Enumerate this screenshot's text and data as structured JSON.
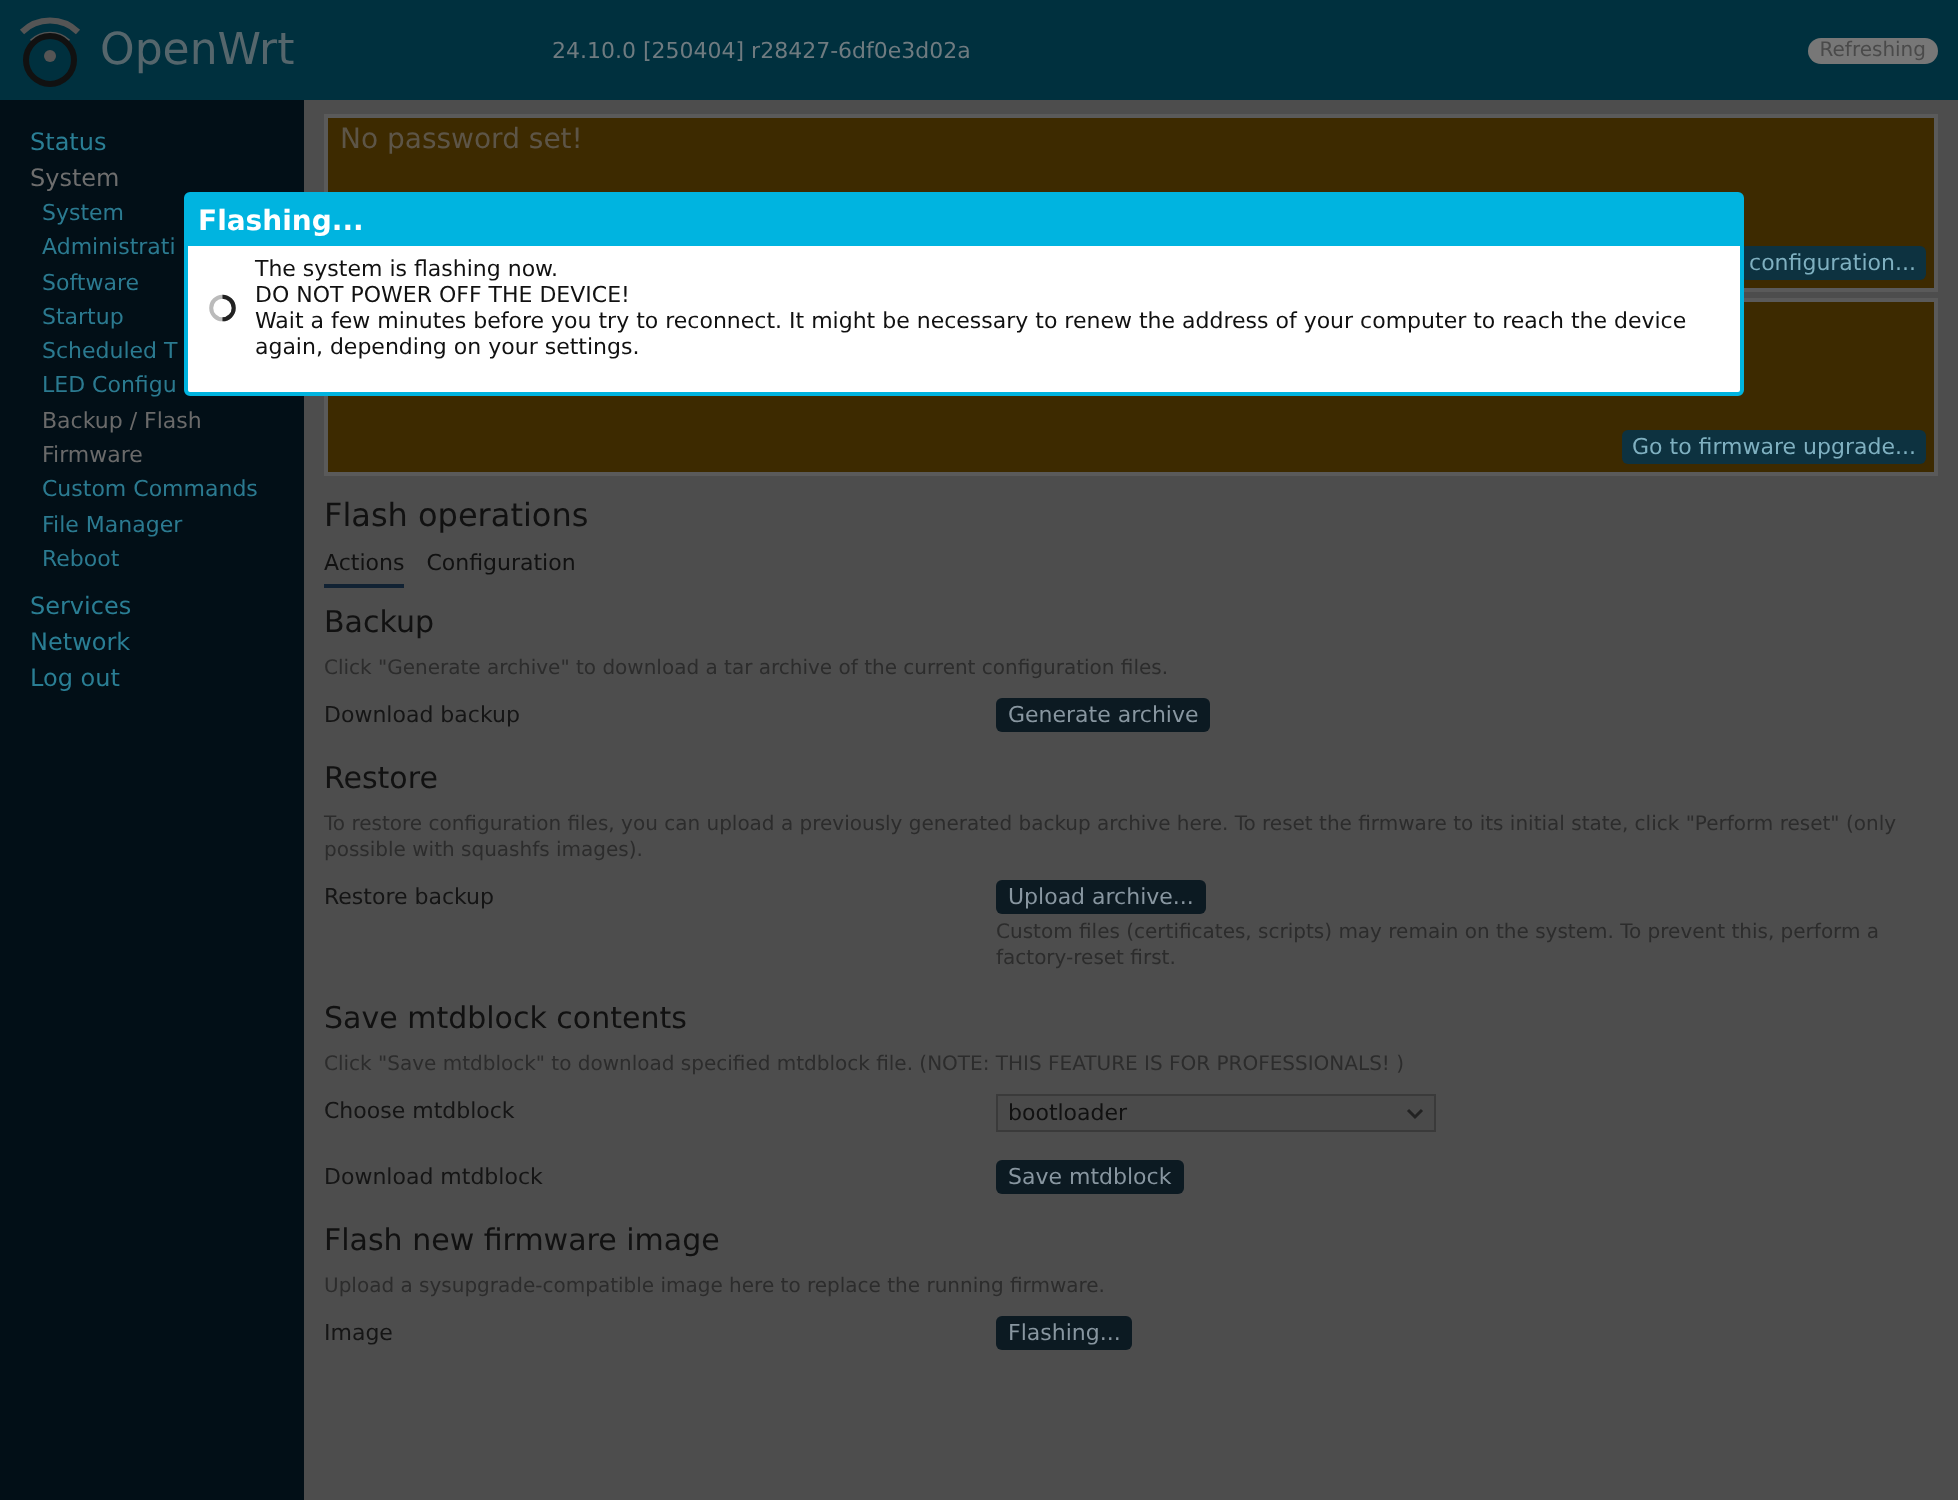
{
  "header": {
    "brand": "OpenWrt",
    "version": "24.10.0 [250404] r28427-6df0e3d02a",
    "indicator": "Refreshing"
  },
  "sidebar": {
    "items": [
      {
        "label": "Status",
        "selected": false
      },
      {
        "label": "System",
        "selected": true,
        "children": [
          {
            "label": "System",
            "selected": false
          },
          {
            "label": "Administrati",
            "selected": false
          },
          {
            "label": "Software",
            "selected": false
          },
          {
            "label": "Startup",
            "selected": false
          },
          {
            "label": "Scheduled T",
            "selected": false
          },
          {
            "label": "LED Configu",
            "selected": false
          },
          {
            "label": "Backup / Flash",
            "selected": true
          },
          {
            "label": "Firmware",
            "selected": true
          },
          {
            "label": "Custom Commands",
            "selected": false
          },
          {
            "label": "File Manager",
            "selected": false
          },
          {
            "label": "Reboot",
            "selected": false
          }
        ]
      },
      {
        "label": "Services",
        "selected": false
      },
      {
        "label": "Network",
        "selected": false
      },
      {
        "label": "Log out",
        "selected": false
      }
    ]
  },
  "banners": [
    {
      "title": "No password set!",
      "button": "configuration..."
    },
    {
      "button": "Go to firmware upgrade..."
    }
  ],
  "page": {
    "title": "Flash operations",
    "tabs": [
      {
        "label": "Actions",
        "selected": true
      },
      {
        "label": "Configuration",
        "selected": false
      }
    ],
    "sections": [
      {
        "title": "Backup",
        "description": "Click \"Generate archive\" to download a tar archive of the current configuration files.",
        "rows": [
          {
            "label": "Download backup",
            "kind": "button",
            "value": "Generate archive"
          }
        ]
      },
      {
        "title": "Restore",
        "description": "To restore configuration files, you can upload a previously generated backup archive here. To reset the firmware to its initial state, click \"Perform reset\" (only possible with squashfs images).",
        "rows": [
          {
            "label": "Restore backup",
            "kind": "button",
            "value": "Upload archive...",
            "note": "Custom files (certificates, scripts) may remain on the system. To prevent this, perform a factory-reset first."
          }
        ]
      },
      {
        "title": "Save mtdblock contents",
        "description": "Click \"Save mtdblock\" to download specified mtdblock file. (NOTE: THIS FEATURE IS FOR PROFESSIONALS! )",
        "rows": [
          {
            "label": "Choose mtdblock",
            "kind": "select",
            "value": "bootloader"
          },
          {
            "label": "Download mtdblock",
            "kind": "button",
            "value": "Save mtdblock"
          }
        ]
      },
      {
        "title": "Flash new firmware image",
        "description": "Upload a sysupgrade-compatible image here to replace the running firmware.",
        "rows": [
          {
            "label": "Image",
            "kind": "button",
            "value": "Flashing..."
          }
        ]
      }
    ]
  },
  "modal": {
    "title": "Flashing...",
    "lines": [
      "The system is flashing now.",
      "DO NOT POWER OFF THE DEVICE!",
      "Wait a few minutes before you try to reconnect. It might be necessary to renew the address of your computer to reach the device again, depending on your settings."
    ]
  }
}
